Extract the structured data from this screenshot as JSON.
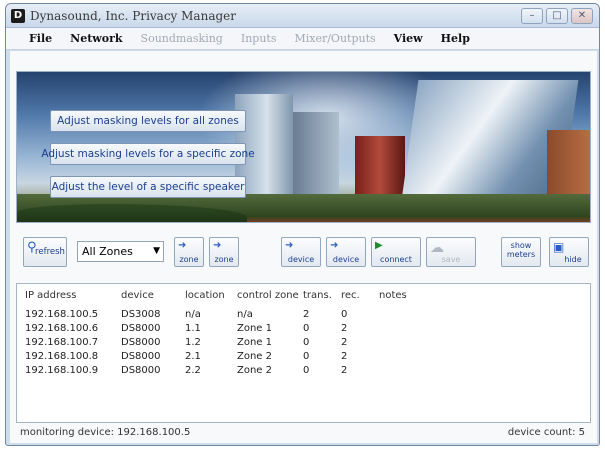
{
  "window": {
    "title": "Dynasound, Inc. Privacy Manager",
    "app_icon_glyph": "D",
    "controls": {
      "minimize": "–",
      "maximize": "□",
      "close": "✕"
    }
  },
  "menu": [
    {
      "label": "File",
      "enabled": true
    },
    {
      "label": "Network",
      "enabled": true
    },
    {
      "label": "Soundmasking",
      "enabled": false
    },
    {
      "label": "Inputs",
      "enabled": false
    },
    {
      "label": "Mixer/Outputs",
      "enabled": false
    },
    {
      "label": "View",
      "enabled": true
    },
    {
      "label": "Help",
      "enabled": true
    }
  ],
  "banner_buttons": [
    {
      "label": "Adjust masking levels for all zones"
    },
    {
      "label": "Adjust masking levels for a specific zone"
    },
    {
      "label": "Adjust the level of a specific speaker"
    }
  ],
  "toolbar": {
    "refresh": {
      "label": "refresh",
      "icon": "magnifier-icon"
    },
    "zone_select": {
      "value": "All Zones"
    },
    "buttons": [
      {
        "name": "add-zone-button",
        "label": "zone",
        "icon": "plus-arrow-icon"
      },
      {
        "name": "remove-zone-button",
        "label": "zone",
        "icon": "minus-arrow-icon"
      },
      {
        "name": "add-device-button",
        "label": "device",
        "icon": "plus-arrow-icon"
      },
      {
        "name": "remove-device-button",
        "label": "device",
        "icon": "minus-arrow-icon"
      },
      {
        "name": "connect-button",
        "label": "connect",
        "icon": "play-icon"
      },
      {
        "name": "save-button",
        "label": "save",
        "icon": "cloud-icon",
        "enabled": false
      },
      {
        "name": "show-meters-button",
        "label": "show\nmeters",
        "icon": ""
      },
      {
        "name": "hide-button",
        "label": "hide",
        "icon": "window-icon"
      }
    ]
  },
  "device_list": {
    "columns": [
      "IP address",
      "device",
      "location",
      "control zone",
      "trans.",
      "rec.",
      "notes"
    ],
    "rows": [
      [
        "192.168.100.5",
        "DS3008",
        "n/a",
        "n/a",
        "2",
        "0",
        ""
      ],
      [
        "192.168.100.6",
        "DS8000",
        "1.1",
        "Zone 1",
        "0",
        "2",
        ""
      ],
      [
        "192.168.100.7",
        "DS8000",
        "1.2",
        "Zone 1",
        "0",
        "2",
        ""
      ],
      [
        "192.168.100.8",
        "DS8000",
        "2.1",
        "Zone 2",
        "0",
        "2",
        ""
      ],
      [
        "192.168.100.9",
        "DS8000",
        "2.2",
        "Zone 2",
        "0",
        "2",
        ""
      ]
    ]
  },
  "status": {
    "monitoring": "monitoring device: 192.168.100.5",
    "device_count": "device count: 5"
  }
}
